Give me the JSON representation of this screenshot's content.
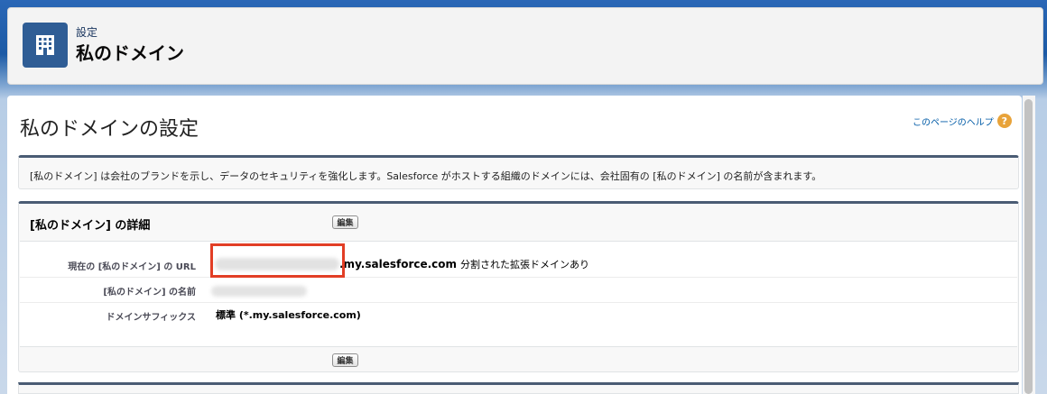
{
  "header": {
    "breadcrumb": "設定",
    "title": "私のドメイン",
    "icon": "building-icon"
  },
  "page": {
    "title": "私のドメインの設定",
    "help_link": "このページのヘルプ",
    "help_icon": "?"
  },
  "description": "[私のドメイン] は会社のブランドを示し、データのセキュリティを強化します。Salesforce がホストする組織のドメインには、会社固有の [私のドメイン] の名前が含まれます。",
  "detail": {
    "title": "[私のドメイン] の詳細",
    "edit_label_top": "編集",
    "edit_label_bottom": "編集",
    "rows": [
      {
        "label": "現在の [私のドメイン] の URL",
        "value_main": ".my.salesforce.com",
        "value_note": "分割された拡張ドメインあり"
      },
      {
        "label": "[私のドメイン] の名前",
        "value_main": ""
      },
      {
        "label": "ドメインサフィックス",
        "value_main": "標準 (*.my.salesforce.com)"
      }
    ]
  },
  "colors": {
    "accent": "#2f5d95",
    "highlight": "#e23e25",
    "link": "#015ba7"
  }
}
